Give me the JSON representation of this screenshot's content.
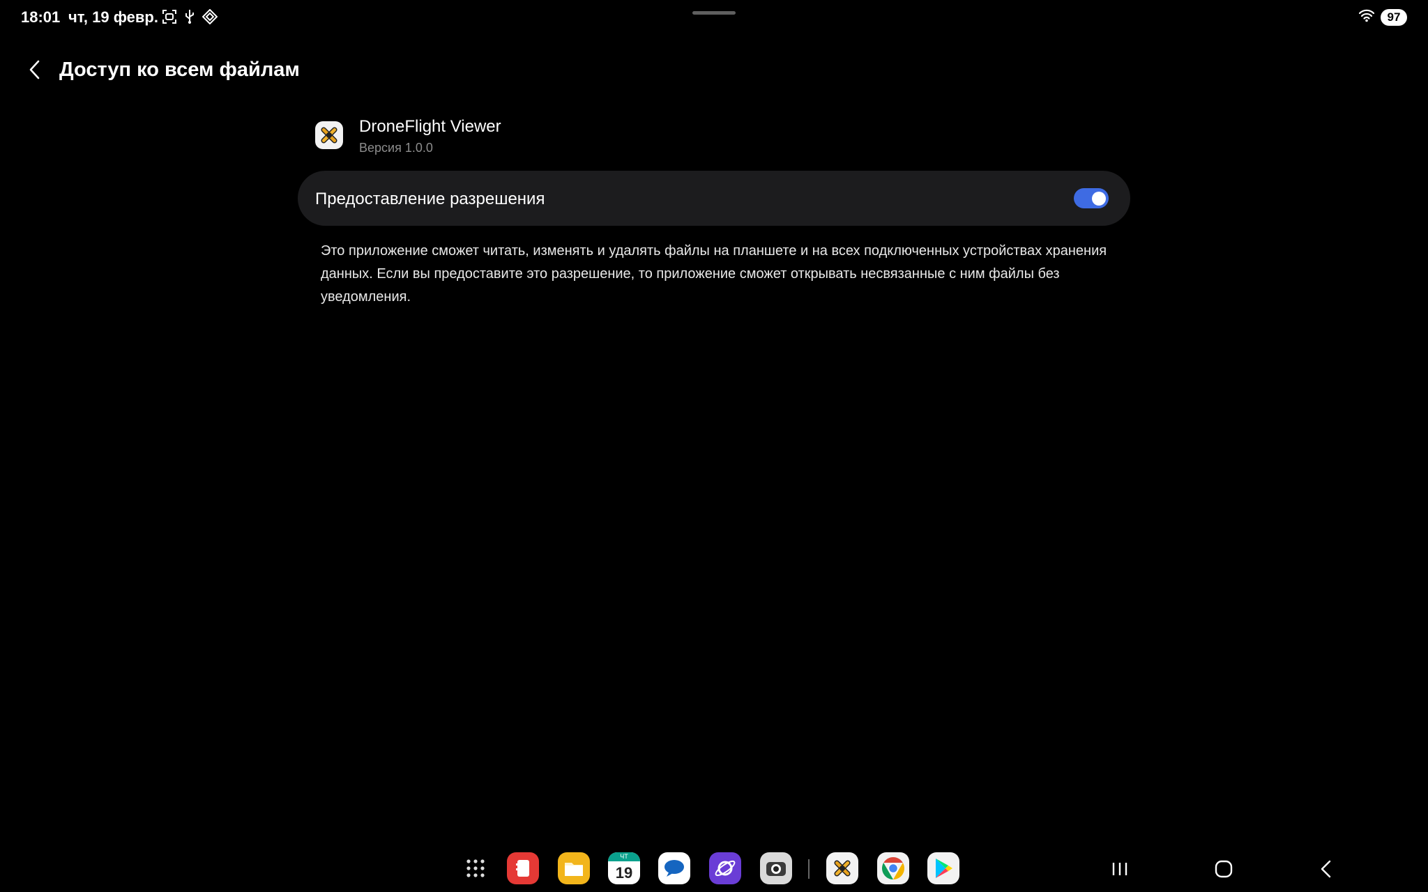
{
  "status_bar": {
    "time": "18:01",
    "date": "чт, 19 февр.",
    "battery": "97"
  },
  "header": {
    "title": "Доступ ко всем файлам"
  },
  "app": {
    "name": "DroneFlight Viewer",
    "version": "Версия 1.0.0"
  },
  "permission": {
    "label": "Предоставление разрешения",
    "enabled": true,
    "accent_color": "#3e6be3"
  },
  "description": "Это приложение сможет читать, изменять и удалять файлы на планшете и на всех подключенных устройствах хранения данных. Если вы предоставите это разрешение, то приложение сможет открывать несвязанные с ним файлы без уведомления.",
  "taskbar": {
    "calendar_day": "19",
    "calendar_weekday": "ЧТ",
    "apps": [
      "apps-grid-icon",
      "notes-app-icon",
      "files-app-icon",
      "calendar-app-icon",
      "messages-app-icon",
      "browser-app-icon",
      "camera-app-icon",
      "droneflight-app-icon",
      "chrome-app-icon",
      "play-store-app-icon"
    ]
  }
}
